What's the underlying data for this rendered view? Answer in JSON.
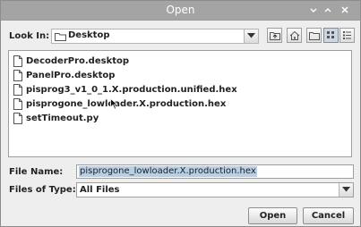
{
  "window": {
    "title": "Open"
  },
  "look_in": {
    "label": "Look In:",
    "value": "Desktop"
  },
  "toolbar": {
    "icons": [
      "up-folder-icon",
      "home-icon",
      "new-folder-icon",
      "list-view-icon",
      "details-view-icon"
    ]
  },
  "files": [
    {
      "name": "DecoderPro.desktop"
    },
    {
      "name": "PanelPro.desktop"
    },
    {
      "name": "pisprog3_v1_0_1.X.production.unified.hex"
    },
    {
      "name": "pisprogone_lowloader.X.production.hex"
    },
    {
      "name": "setTimeout.py"
    }
  ],
  "file_name": {
    "label": "File Name:",
    "value": "pisprogone_lowloader.X.production.hex"
  },
  "file_type": {
    "label": "Files of Type:",
    "value": "All Files"
  },
  "buttons": {
    "open": "Open",
    "cancel": "Cancel"
  },
  "colors": {
    "titlebar": "#a4a4a4",
    "selection": "#b8cfe5"
  }
}
